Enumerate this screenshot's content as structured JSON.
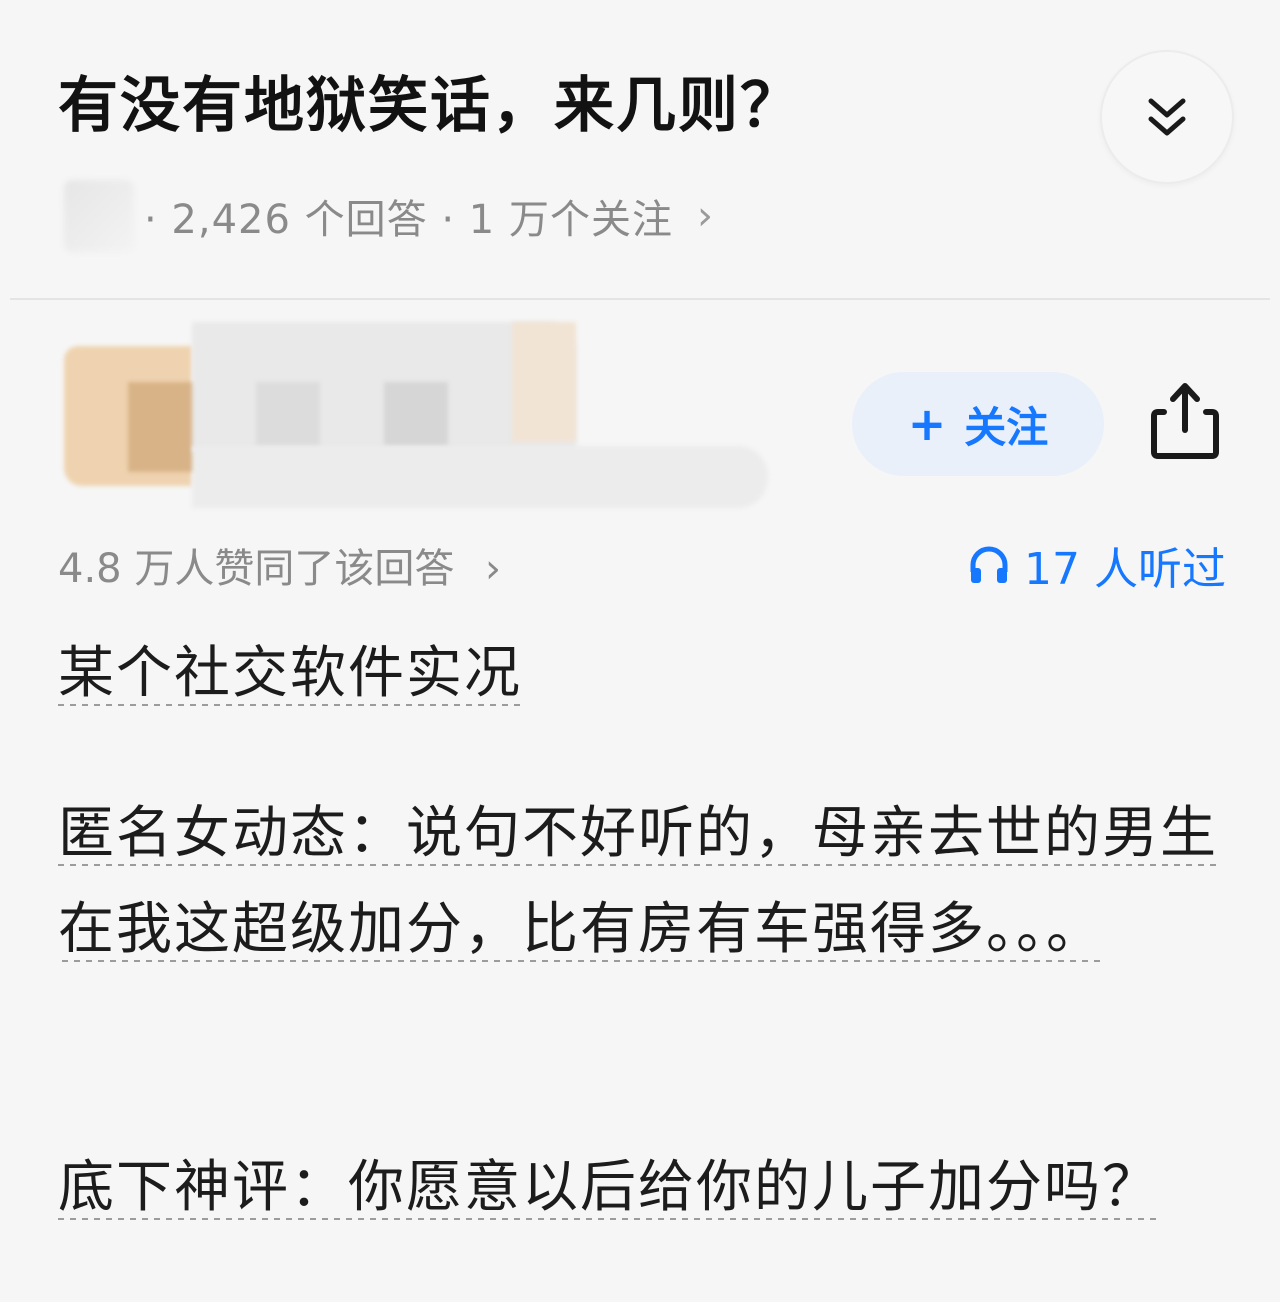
{
  "question": {
    "title": "有没有地狱笑话，来几则？",
    "meta_text": "· 2,426 个回答 · 1 万个关注",
    "meta_chevron": "›"
  },
  "answer": {
    "follow_label": "关注",
    "follow_plus": "+",
    "approval_text": "4.8 万人赞同了该回答",
    "approval_chevron": "›",
    "listen_text": "17 人听过",
    "paragraphs": [
      "某个社交软件实况",
      "匿名女动态：说句不好听的，母亲去世的男生在我这超级加分，比有房有车强得多。。。",
      "底下神评：你愿意以后给你的儿子加分吗？"
    ]
  },
  "icons": {
    "collapse": "double-chevron-down-icon",
    "share": "share-icon",
    "listen": "headphones-icon"
  },
  "colors": {
    "accent": "#1677ff",
    "follow_bg": "#e9f0fa",
    "background": "#f6f6f6",
    "meta_text": "#8a8a8a"
  }
}
